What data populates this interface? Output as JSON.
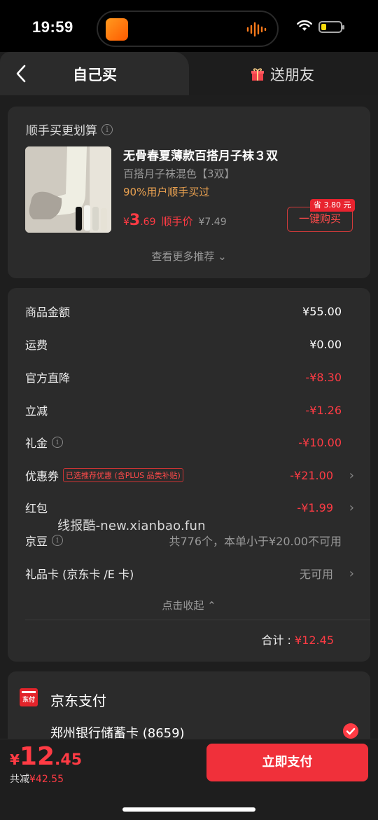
{
  "status_bar": {
    "time": "19:59"
  },
  "tabs": {
    "self": "自己买",
    "gift": "送朋友"
  },
  "recommend": {
    "title": "顺手买更划算",
    "product_name": "无骨春夏薄款百搭月子袜３双",
    "product_spec": "百搭月子袜混色【3双】",
    "product_stat": "90%用户顺手买过",
    "price_currency": "¥",
    "price_int": "3",
    "price_dec": ".69",
    "price_tag": "顺手价",
    "price_original": "¥7.49",
    "save_tag": "省 3.80 元",
    "buy_button": "一键购买",
    "more": "查看更多推荐 ⌄"
  },
  "summary": {
    "rows": [
      {
        "label": "商品金额",
        "value": "¥55.00"
      },
      {
        "label": "运费",
        "value": "¥0.00"
      },
      {
        "label": "官方直降",
        "value": "-¥8.30"
      },
      {
        "label": "立减",
        "value": "-¥1.26"
      },
      {
        "label": "礼金",
        "value": "-¥10.00"
      },
      {
        "label": "优惠券",
        "value": "-¥21.00",
        "tag": "已选推荐优惠 (含PLUS 品类补贴)"
      },
      {
        "label": "红包",
        "value": "-¥1.99"
      },
      {
        "label": "京豆",
        "value": "共776个，本单小于¥20.00不可用"
      },
      {
        "label": "礼品卡 (京东卡 /E 卡)",
        "value": "无可用"
      }
    ],
    "collapse": "点击收起 ⌃",
    "total_label": "合计 : ",
    "total_value": "¥12.45"
  },
  "watermark": "线报酷-new.xianbao.fun",
  "payment": {
    "icon_text": "东付",
    "title": "京东支付",
    "bank": "郑州银行储蓄卡 (8659)"
  },
  "bottom": {
    "currency": "¥",
    "total_int": "12",
    "total_dec": ".45",
    "saved_label": "共减",
    "saved_value": "¥42.55",
    "pay_button": "立即支付"
  },
  "colors": {
    "accent": "#ff3b44",
    "background": "#1e1e1e",
    "card": "#2b2b2b"
  }
}
